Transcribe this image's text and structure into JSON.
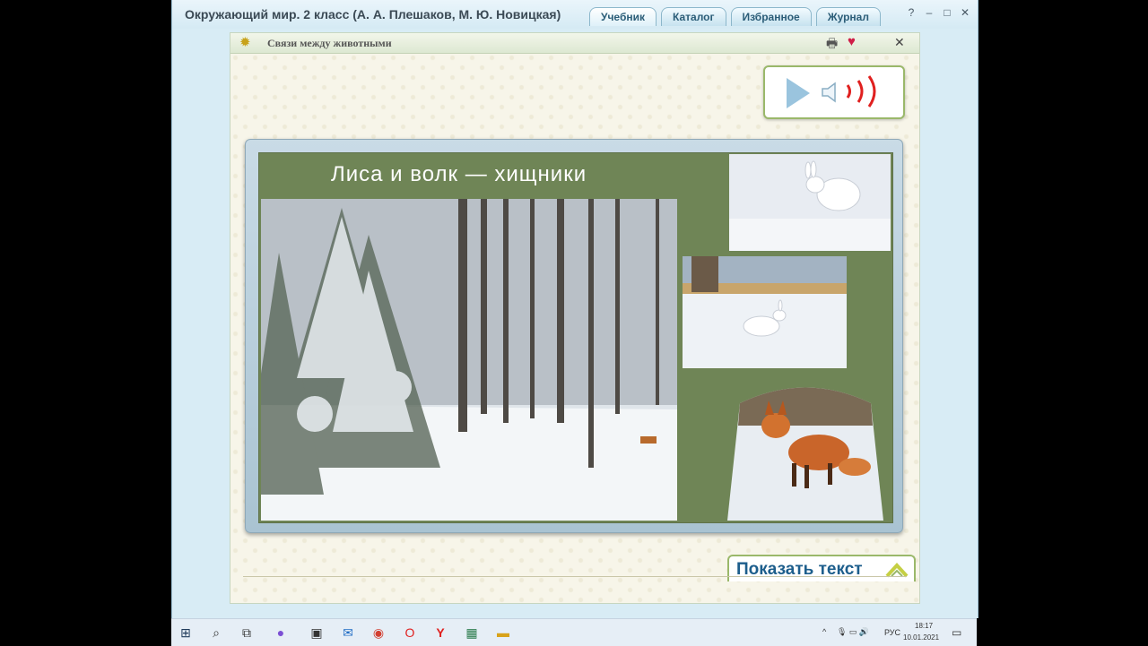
{
  "window": {
    "title": "Окружающий мир. 2 класс (А. А. Плешаков, М. Ю. Новицкая)",
    "tabs": [
      {
        "label": "Учебник",
        "active": true
      },
      {
        "label": "Каталог",
        "active": false
      },
      {
        "label": "Избранное",
        "active": false
      },
      {
        "label": "Журнал",
        "active": false
      }
    ],
    "controls": {
      "help": "?",
      "minimize": "‒",
      "maximize": "□",
      "close": "✕"
    }
  },
  "panel": {
    "title": "Связи между животными",
    "icons": {
      "left": "sun-icon",
      "print": "printer-icon",
      "favorite": "heart-icon",
      "close": "close-icon"
    },
    "close_glyph": "✕"
  },
  "audio": {
    "play_icon": "play-icon",
    "speaker_icon": "speaker-icon",
    "waves_icon": "sound-waves-icon"
  },
  "slide": {
    "title": "Лиса  и  волк  —  хищники",
    "photos": [
      "forest-photo",
      "hare-photo",
      "hare-photo",
      "fox-photo"
    ]
  },
  "show_text_button": {
    "label": "Показать текст",
    "icon": "chevron-up-icon"
  },
  "taskbar": {
    "items": [
      "windows-icon",
      "search-icon",
      "task-view-icon",
      "cortana-icon",
      "store-icon",
      "mail-icon",
      "chrome-icon",
      "opera-icon",
      "yandex-icon",
      "app-icon",
      "explorer-icon"
    ],
    "tray": {
      "lang": "РУС",
      "time": "18:17",
      "date": "10.01.2021"
    }
  },
  "colors": {
    "accent": "#1d5e8c",
    "slide_bg": "#6f8556",
    "heart": "#d01e48",
    "button_border": "#9ab86a"
  }
}
